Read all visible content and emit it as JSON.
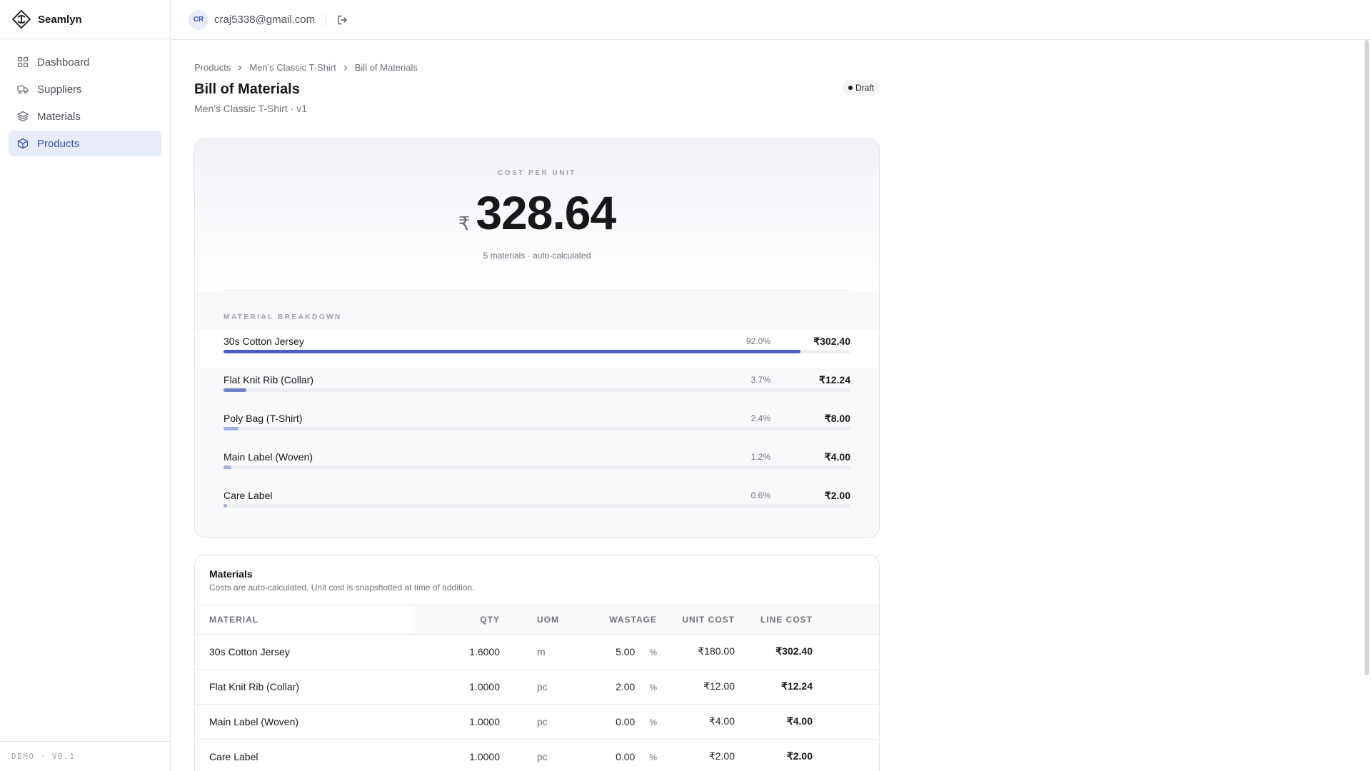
{
  "app": {
    "name": "Seamlyn"
  },
  "sidebar": {
    "items": [
      {
        "label": "Dashboard",
        "icon": "grid-icon"
      },
      {
        "label": "Suppliers",
        "icon": "truck-icon"
      },
      {
        "label": "Materials",
        "icon": "layers-icon"
      },
      {
        "label": "Products",
        "icon": "box-icon",
        "active": true
      }
    ],
    "footer": "DEMO · V0.1"
  },
  "topbar": {
    "avatar_initials": "CR",
    "email": "craj5338@gmail.com"
  },
  "breadcrumb": [
    "Products",
    "Men's Classic T-Shirt",
    "Bill of Materials"
  ],
  "page": {
    "title": "Bill of Materials",
    "subtitle": "Men's Classic T-Shirt · v1",
    "status": "Draft"
  },
  "cost": {
    "label": "COST PER UNIT",
    "currency": "₹",
    "value": "328.64",
    "note": "5 materials · auto-calculated"
  },
  "breakdown": {
    "title": "MATERIAL BREAKDOWN",
    "items": [
      {
        "name": "30s Cotton Jersey",
        "pct": "92.0%",
        "amount": "₹302.40",
        "share": 0.92,
        "color": "#4f5bc4"
      },
      {
        "name": "Flat Knit Rib (Collar)",
        "pct": "3.7%",
        "amount": "₹12.24",
        "share": 0.037,
        "color": "#6a83c9"
      },
      {
        "name": "Poly Bag (T-Shirt)",
        "pct": "2.4%",
        "amount": "₹8.00",
        "share": 0.024,
        "color": "#9fb0dd"
      },
      {
        "name": "Main Label (Woven)",
        "pct": "1.2%",
        "amount": "₹4.00",
        "share": 0.012,
        "color": "#9fb0dd"
      },
      {
        "name": "Care Label",
        "pct": "0.6%",
        "amount": "₹2.00",
        "share": 0.006,
        "color": "#9fb0dd"
      }
    ]
  },
  "materials": {
    "title": "Materials",
    "description": "Costs are auto-calculated. Unit cost is snapshotted at time of addition.",
    "columns": [
      "MATERIAL",
      "QTY",
      "UOM",
      "WASTAGE",
      "UNIT COST",
      "LINE COST"
    ],
    "rows": [
      {
        "material": "30s Cotton Jersey",
        "qty": "1.6000",
        "uom": "m",
        "wastage": "5.00",
        "wastage_unit": "%",
        "unit_cost": "₹180.00",
        "line_cost": "₹302.40"
      },
      {
        "material": "Flat Knit Rib (Collar)",
        "qty": "1.0000",
        "uom": "pc",
        "wastage": "2.00",
        "wastage_unit": "%",
        "unit_cost": "₹12.00",
        "line_cost": "₹12.24"
      },
      {
        "material": "Main Label (Woven)",
        "qty": "1.0000",
        "uom": "pc",
        "wastage": "0.00",
        "wastage_unit": "%",
        "unit_cost": "₹4.00",
        "line_cost": "₹4.00"
      },
      {
        "material": "Care Label",
        "qty": "1.0000",
        "uom": "pc",
        "wastage": "0.00",
        "wastage_unit": "%",
        "unit_cost": "₹2.00",
        "line_cost": "₹2.00"
      }
    ]
  }
}
